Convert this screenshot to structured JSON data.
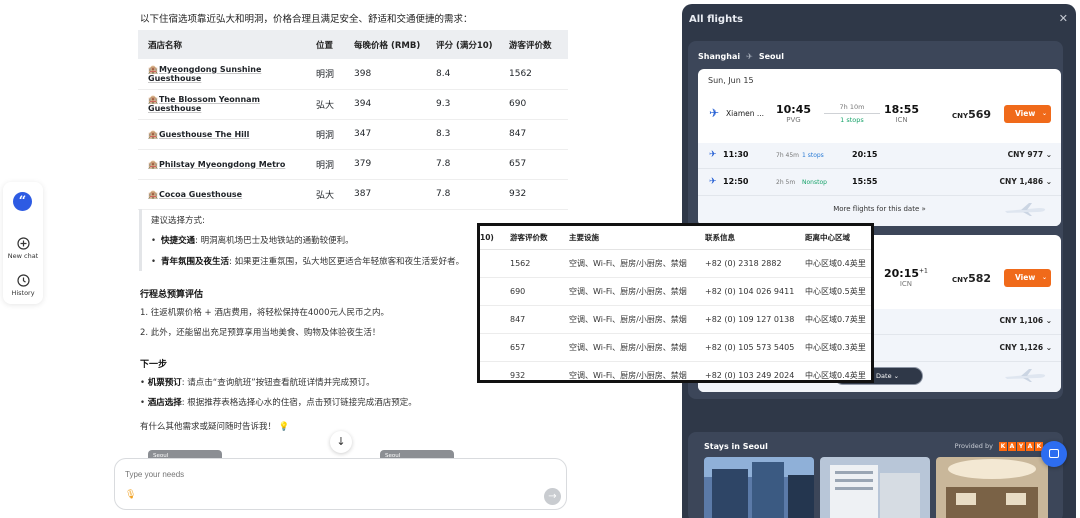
{
  "rail": {
    "quote_glyph": "“",
    "new_chat_label": "New chat",
    "history_label": "History"
  },
  "chat": {
    "intro": "以下住宿选项靠近弘大和明洞，价格合理且满足安全、舒适和交通便捷的需求：",
    "hotel_table": {
      "headers": [
        "酒店名称",
        "位置",
        "每晚价格 (RMB)",
        "评分 (满分10)",
        "游客评价数"
      ],
      "rows": [
        [
          "Myeongdong Sunshine Guesthouse",
          "明洞",
          "398",
          "8.4",
          "1562"
        ],
        [
          "The Blossom Yeonnam Guesthouse",
          "弘大",
          "394",
          "9.3",
          "690"
        ],
        [
          "Guesthouse The Hill",
          "明洞",
          "347",
          "8.3",
          "847"
        ],
        [
          "Philstay Myeongdong Metro",
          "明洞",
          "379",
          "7.8",
          "657"
        ],
        [
          "Cocoa Guesthouse",
          "弘大",
          "387",
          "7.8",
          "932"
        ]
      ]
    },
    "suggestion": {
      "title": "建议选择方式:",
      "items": [
        {
          "bold": "快捷交通",
          "text": ": 明洞离机场巴士及地铁站的通勤较便利。"
        },
        {
          "bold": "青年氛围及夜生活",
          "text": ": 如果更注重氛围，弘大地区更适合年轻旅客和夜生活爱好者。"
        }
      ]
    },
    "budget": {
      "title": "行程总预算评估",
      "lines": [
        "1. 往返机票价格 + 酒店费用，将轻松保持在4000元人民币之内。",
        "2. 此外，还能留出充足预算享用当地美食、购物及体验夜生活！"
      ]
    },
    "next": {
      "title": "下一步",
      "items": [
        {
          "bold": "机票预订",
          "text": ": 请点击“查询航班”按钮查看航班详情并完成预订。"
        },
        {
          "bold": "酒店选择",
          "text": ": 根据推荐表格选择心水的住宿，点击预订链接完成酒店预定。"
        }
      ]
    },
    "closing": "有什么其他需求或疑问随时告诉我！",
    "closing_emoji": "💡",
    "thumb_label": "Seoul",
    "input_placeholder": "Type your needs"
  },
  "flights": {
    "panel_title": "All flights",
    "origin": "Shanghai",
    "destination": "Seoul",
    "day1": {
      "date": "Sun, Jun 15",
      "main": {
        "airline": "Xiamen ...",
        "dep_time": "10:45",
        "dep_airport": "PVG",
        "duration": "7h 10m",
        "stops": "1 stops",
        "arr_time": "18:55",
        "arr_airport": "ICN",
        "currency": "CNY",
        "price": "569",
        "view_label": "View"
      },
      "others": [
        {
          "dep": "11:30",
          "duration": "7h 45m",
          "stops": "1 stops",
          "arr": "20:15",
          "price": "CNY 977"
        },
        {
          "dep": "12:50",
          "duration": "2h 5m",
          "stops": "Nonstop",
          "arr": "15:55",
          "price": "CNY 1,486"
        }
      ],
      "more_label": "More flights for this date »"
    },
    "day2": {
      "main": {
        "arr_time": "20:15",
        "arr_sup": "+1",
        "arr_airport": "ICN",
        "currency": "CNY",
        "price": "582",
        "view_label": "View"
      },
      "others": [
        {
          "arr_partial": "5",
          "price": "CNY 1,106"
        },
        {
          "arr_partial": "0",
          "price": "CNY 1,126"
        }
      ],
      "more_label": "his date »"
    },
    "more_date_label": "More Date",
    "stays_title": "Stays in Seoul",
    "provided_by": "Provided by",
    "provider_letters": [
      "K",
      "A",
      "Y",
      "A",
      "K"
    ]
  },
  "zoom_table": {
    "headers": [
      "10)",
      "游客评价数",
      "主要设施",
      "联系信息",
      "距离中心区域"
    ],
    "rows": [
      [
        "",
        "1562",
        "空调、Wi-Fi、厨房/小厨房、禁烟",
        "+82 (0) 2318 2882",
        "中心区域0.4英里"
      ],
      [
        "",
        "690",
        "空调、Wi-Fi、厨房/小厨房、禁烟",
        "+82 (0) 104 026 9411",
        "中心区域0.5英里"
      ],
      [
        "",
        "847",
        "空调、Wi-Fi、厨房/小厨房、禁烟",
        "+82 (0) 109 127 0138",
        "中心区域0.7英里"
      ],
      [
        "",
        "657",
        "空调、Wi-Fi、厨房/小厨房、禁烟",
        "+82 (0) 105 573 5405",
        "中心区域0.3英里"
      ],
      [
        "",
        "932",
        "空调、Wi-Fi、厨房/小厨房、禁烟",
        "+82 (0) 103 249 2024",
        "中心区域0.4英里"
      ]
    ]
  },
  "colors": {
    "accent_blue": "#2d5be3",
    "view_orange": "#f06a1a",
    "panel_dark": "#2f3848",
    "nonstop_green": "#17a36a"
  }
}
